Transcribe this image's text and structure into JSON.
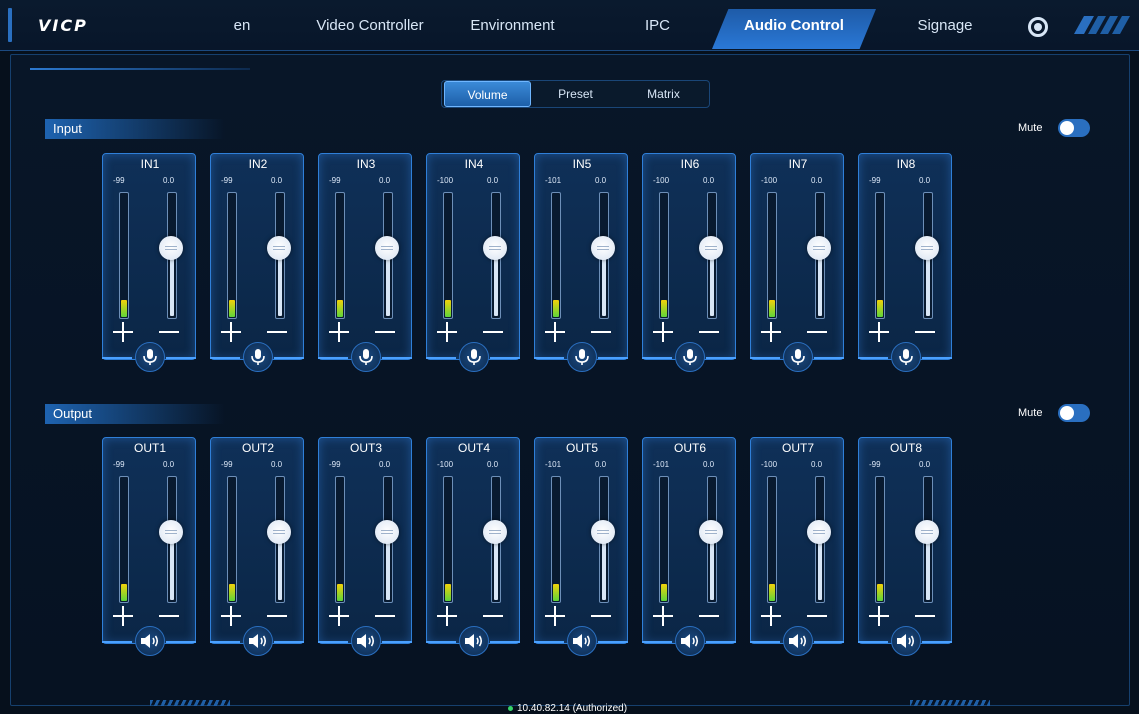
{
  "header": {
    "logo": "VICP",
    "nav": [
      {
        "label": "en",
        "active": false
      },
      {
        "label": "Video Controller",
        "active": false
      },
      {
        "label": "Environment",
        "active": false
      },
      {
        "label": "IPC",
        "active": false
      },
      {
        "label": "Audio Control",
        "active": true
      },
      {
        "label": "Signage",
        "active": false
      }
    ],
    "settings_icon": "gear-icon"
  },
  "tabs": [
    {
      "label": "Volume",
      "active": true
    },
    {
      "label": "Preset",
      "active": false
    },
    {
      "label": "Matrix",
      "active": false
    }
  ],
  "input": {
    "title": "Input",
    "mute_label": "Mute",
    "mute_on": true,
    "channels": [
      {
        "name": "IN1",
        "meter": "-99",
        "volume": "0.0",
        "level": 0.15
      },
      {
        "name": "IN2",
        "meter": "-99",
        "volume": "0.0",
        "level": 0.15
      },
      {
        "name": "IN3",
        "meter": "-99",
        "volume": "0.0",
        "level": 0.15
      },
      {
        "name": "IN4",
        "meter": "-100",
        "volume": "0.0",
        "level": 0.15
      },
      {
        "name": "IN5",
        "meter": "-101",
        "volume": "0.0",
        "level": 0.15
      },
      {
        "name": "IN6",
        "meter": "-100",
        "volume": "0.0",
        "level": 0.15
      },
      {
        "name": "IN7",
        "meter": "-100",
        "volume": "0.0",
        "level": 0.15
      },
      {
        "name": "IN8",
        "meter": "-99",
        "volume": "0.0",
        "level": 0.15
      }
    ]
  },
  "output": {
    "title": "Output",
    "mute_label": "Mute",
    "mute_on": true,
    "channels": [
      {
        "name": "OUT1",
        "meter": "-99",
        "volume": "0.0",
        "level": 0.15
      },
      {
        "name": "OUT2",
        "meter": "-99",
        "volume": "0.0",
        "level": 0.15
      },
      {
        "name": "OUT3",
        "meter": "-99",
        "volume": "0.0",
        "level": 0.15
      },
      {
        "name": "OUT4",
        "meter": "-100",
        "volume": "0.0",
        "level": 0.15
      },
      {
        "name": "OUT5",
        "meter": "-101",
        "volume": "0.0",
        "level": 0.15
      },
      {
        "name": "OUT6",
        "meter": "-101",
        "volume": "0.0",
        "level": 0.15
      },
      {
        "name": "OUT7",
        "meter": "-100",
        "volume": "0.0",
        "level": 0.15
      },
      {
        "name": "OUT8",
        "meter": "-99",
        "volume": "0.0",
        "level": 0.15
      }
    ]
  },
  "status": {
    "ip": "10.40.82.14 (Authorized)",
    "color": "#37d36a"
  },
  "colors": {
    "accent": "#2a78d6",
    "background": "#06101c",
    "meter_top": "#f2d20a",
    "meter_bottom": "#5fd43a"
  }
}
